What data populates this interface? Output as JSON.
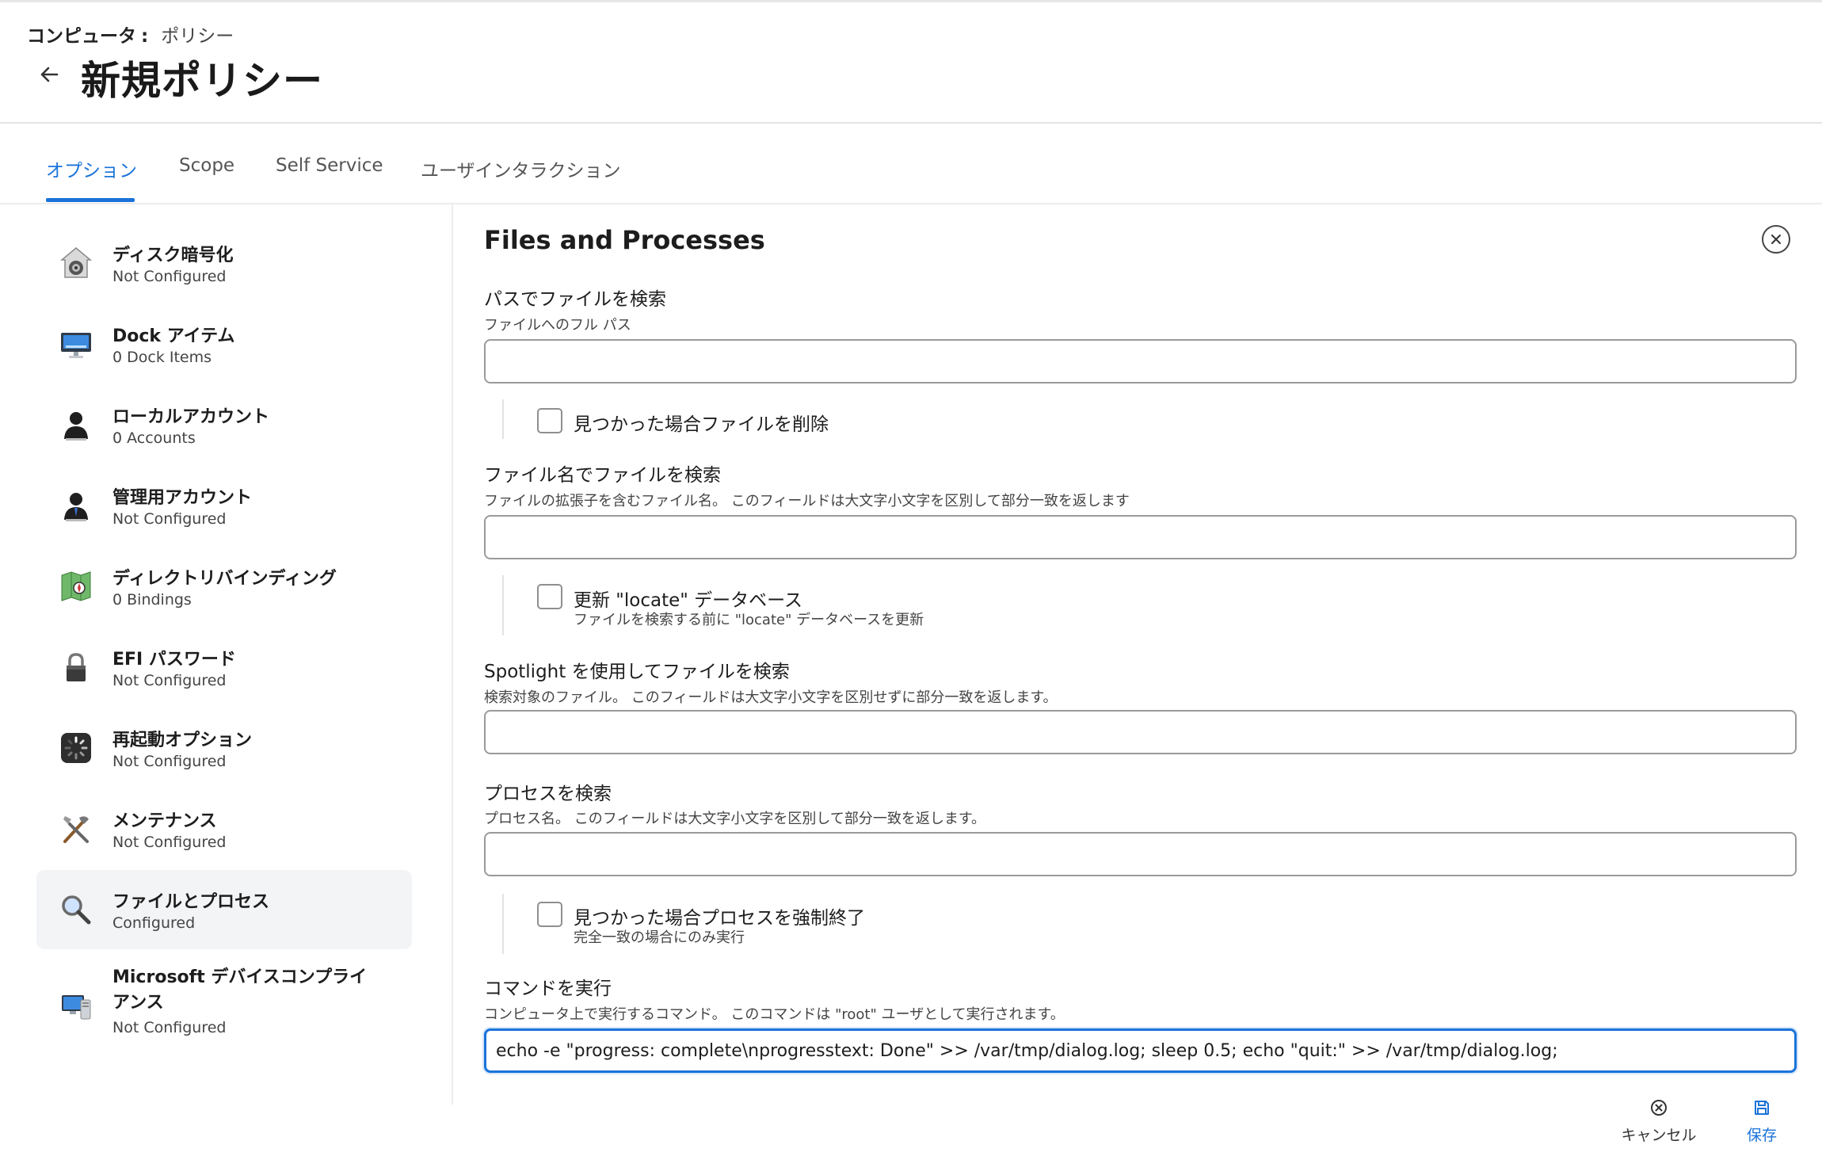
{
  "breadcrumb": {
    "main": "コンピュータ",
    "separator": ":",
    "sub": "ポリシー"
  },
  "page": {
    "title": "新規ポリシー"
  },
  "tabs": [
    {
      "label": "オプション",
      "active": true
    },
    {
      "label": "Scope",
      "active": false
    },
    {
      "label": "Self Service",
      "active": false
    },
    {
      "label": "ユーザインタラクション",
      "active": false
    }
  ],
  "sidebar": {
    "items": [
      {
        "title": "ディスク暗号化",
        "status": "Not Configured",
        "icon": "disk-encryption-icon"
      },
      {
        "title": "Dock アイテム",
        "status": "0 Dock Items",
        "icon": "dock-display-icon"
      },
      {
        "title": "ローカルアカウント",
        "status": "0 Accounts",
        "icon": "user-silhouette-icon"
      },
      {
        "title": "管理用アカウント",
        "status": "Not Configured",
        "icon": "admin-user-icon"
      },
      {
        "title": "ディレクトリバインディング",
        "status": "0 Bindings",
        "icon": "directory-map-icon"
      },
      {
        "title": "EFI パスワード",
        "status": "Not Configured",
        "icon": "padlock-icon"
      },
      {
        "title": "再起動オプション",
        "status": "Not Configured",
        "icon": "restart-spinner-icon"
      },
      {
        "title": "メンテナンス",
        "status": "Not Configured",
        "icon": "tools-icon"
      },
      {
        "title": "ファイルとプロセス",
        "status": "Configured",
        "icon": "magnifier-icon",
        "selected": true
      },
      {
        "title": "Microsoft デバイスコンプライアンス",
        "status": "Not Configured",
        "icon": "compliance-monitor-icon"
      }
    ]
  },
  "panel": {
    "title": "Files and Processes",
    "search_path": {
      "label": "パスでファイルを検索",
      "help": "ファイルへのフル パス",
      "value": ""
    },
    "delete_if_found": {
      "label": "見つかった場合ファイルを削除",
      "checked": false
    },
    "search_filename": {
      "label": "ファイル名でファイルを検索",
      "help": "ファイルの拡張子を含むファイル名。 このフィールドは大文字小文字を区別して部分一致を返します",
      "value": ""
    },
    "update_locate": {
      "label": "更新 \"locate\" データベース",
      "help": "ファイルを検索する前に \"locate\" データベースを更新",
      "checked": false
    },
    "spotlight": {
      "label": "Spotlight を使用してファイルを検索",
      "help": "検索対象のファイル。 このフィールドは大文字小文字を区別せずに部分一致を返します。",
      "value": ""
    },
    "search_process": {
      "label": "プロセスを検索",
      "help": "プロセス名。 このフィールドは大文字小文字を区別して部分一致を返します。",
      "value": ""
    },
    "kill_process": {
      "label": "見つかった場合プロセスを強制終了",
      "help": "完全一致の場合にのみ実行",
      "checked": false
    },
    "run_command": {
      "label": "コマンドを実行",
      "help": "コンピュータ上で実行するコマンド。 このコマンドは \"root\" ユーザとして実行されます。",
      "value": "echo -e \"progress: complete\\nprogresstext: Done\" >> /var/tmp/dialog.log; sleep 0.5; echo \"quit:\" >> /var/tmp/dialog.log;"
    }
  },
  "footer": {
    "cancel_label": "キャンセル",
    "save_label": "保存"
  },
  "colors": {
    "accent": "#1a73d9",
    "selected_bg": "#f3f4f6",
    "border": "#9a9a9a"
  }
}
